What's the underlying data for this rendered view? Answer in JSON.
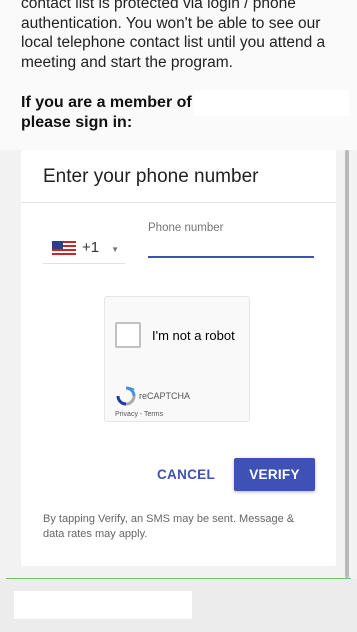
{
  "intro": {
    "line1": "contact list is protected via login / phone",
    "line2": "authentication. You won't be able to see our",
    "line3": "local telephone contact list until you attend a",
    "line4": "meeting and start the program."
  },
  "member_prompt": {
    "line1": "If you are a member of",
    "line2": "please sign in:"
  },
  "card": {
    "title": "Enter your phone number",
    "country": {
      "flag_icon": "us-flag-icon",
      "dial_code": "+1",
      "chevron_glyph": "▼"
    },
    "phone": {
      "label": "Phone number",
      "value": "",
      "placeholder": ""
    },
    "recaptcha": {
      "label": "I'm not a robot",
      "brand": "reCAPTCHA",
      "links": "Privacy - Terms"
    },
    "cancel_label": "CANCEL",
    "verify_label": "VERIFY",
    "terms": "By tapping Verify, an SMS may be sent. Message & data rates may apply."
  },
  "colors": {
    "accent": "#3f51b5",
    "footer_line": "#7cb974"
  }
}
